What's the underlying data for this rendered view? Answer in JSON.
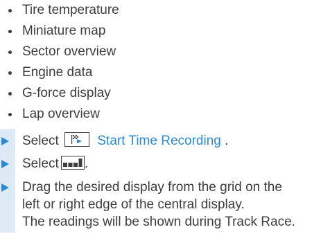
{
  "bullets": [
    {
      "label": "Tire temperature"
    },
    {
      "label": "Miniature map"
    },
    {
      "label": "Sector overview"
    },
    {
      "label": "Engine data"
    },
    {
      "label": "G-force display"
    },
    {
      "label": "Lap overview"
    }
  ],
  "steps": {
    "step1": {
      "prefix": "Select",
      "icon": "race-flag-icon",
      "link": "Start Time Recording",
      "suffix": "."
    },
    "step2": {
      "prefix": "Select",
      "icon": "display-layout-icon",
      "suffix": "."
    },
    "step3": {
      "line1": "Drag the desired display from the grid on the",
      "line2": "left or right edge of the central display.",
      "line3": "The readings will be shown during Track Race."
    }
  },
  "colors": {
    "text": "#3d3d3d",
    "accent": "#2a8ad2",
    "step_bar": "#dde9f5"
  }
}
